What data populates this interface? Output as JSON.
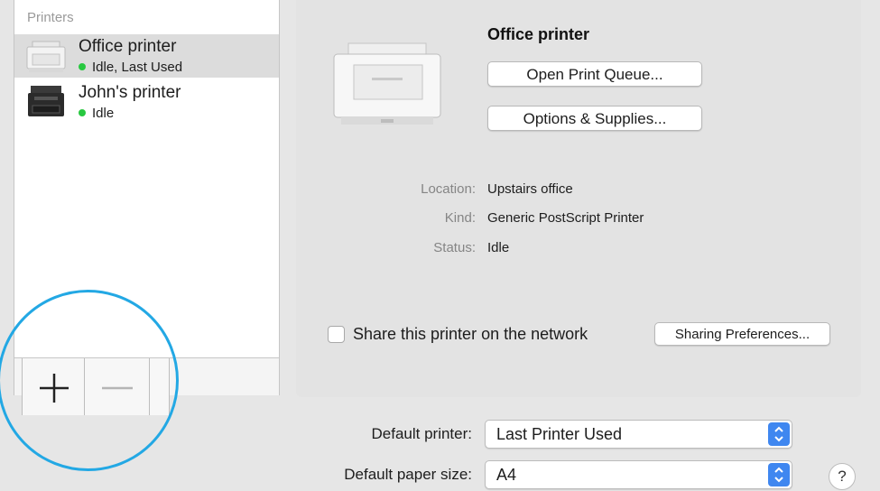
{
  "colors": {
    "status_idle": "#28c840",
    "highlight_ring": "#23a8e4",
    "select_accent": "#3f87f0"
  },
  "sidebar": {
    "header": "Printers",
    "printers": [
      {
        "name": "Office printer",
        "status": "Idle, Last Used",
        "icon": "laser-printer-icon"
      },
      {
        "name": "John's printer",
        "status": "Idle",
        "icon": "multifunction-printer-icon"
      }
    ],
    "add_icon": "plus-icon",
    "remove_icon": "minus-icon"
  },
  "detail": {
    "title": "Office printer",
    "open_queue_label": "Open Print Queue...",
    "options_label": "Options & Supplies...",
    "location_label": "Location:",
    "location_value": "Upstairs office",
    "kind_label": "Kind:",
    "kind_value": "Generic PostScript Printer",
    "status_label": "Status:",
    "status_value": "Idle",
    "share_label": "Share this printer on the network",
    "share_checked": false,
    "sharing_prefs_label": "Sharing Preferences..."
  },
  "defaults": {
    "default_printer_label": "Default printer:",
    "default_printer_value": "Last Printer Used",
    "paper_size_label": "Default paper size:",
    "paper_size_value": "A4",
    "help_label": "?"
  }
}
